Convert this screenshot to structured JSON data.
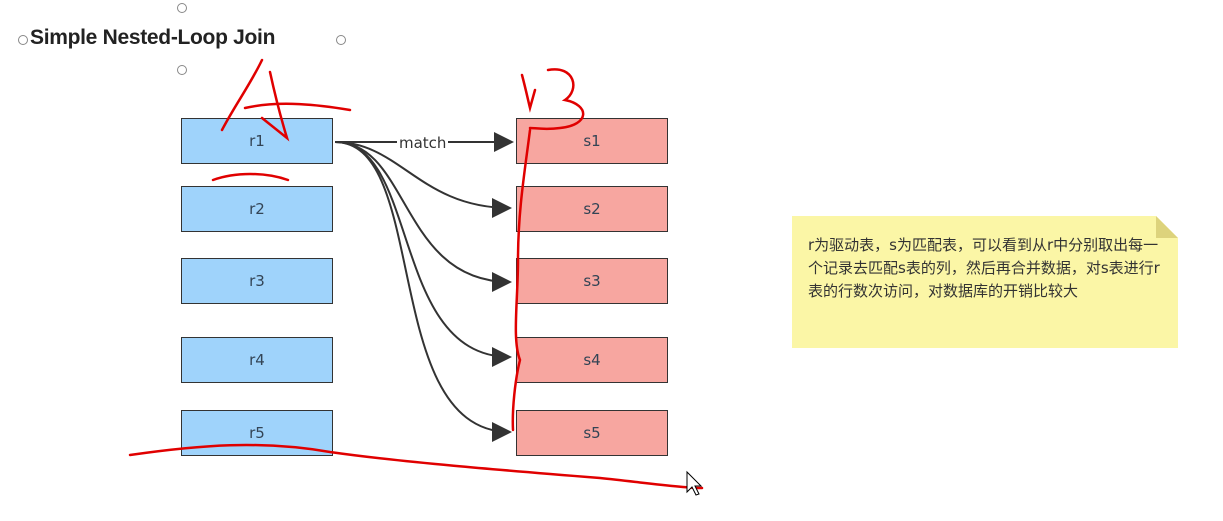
{
  "title": "Simple Nested-Loop Join",
  "r_rows": [
    "r1",
    "r2",
    "r3",
    "r4",
    "r5"
  ],
  "s_rows": [
    "s1",
    "s2",
    "s3",
    "s4",
    "s5"
  ],
  "edge_label": "match",
  "note": "r为驱动表，s为匹配表，可以看到从r中分别取出每一个记录去匹配s表的列，然后再合并数据，对s表进行r表的行数次访问，对数据库的开销比较大",
  "colors": {
    "r_fill": "#9fd3fb",
    "s_fill": "#f7a6a0",
    "note_fill": "#fbf6a6",
    "annotation": "#e00000"
  }
}
